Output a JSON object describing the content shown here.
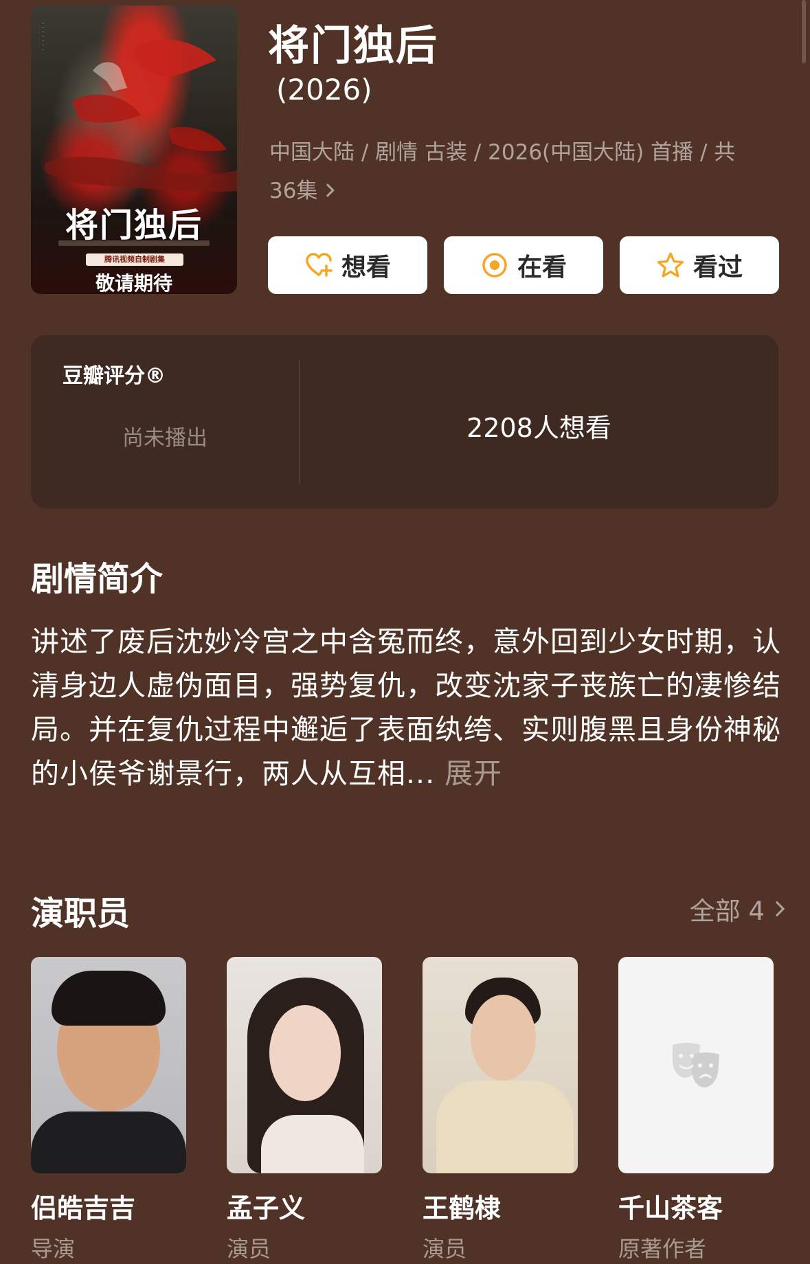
{
  "header": {
    "title": "将门独后",
    "year": "(2026)",
    "meta_line": "中国大陆 / 剧情 古装 / 2026(中国大陆) 首播 / 共 36集"
  },
  "poster": {
    "title": "将门独后",
    "badge": "腾讯视频自制剧集",
    "tagline": "敬请期待"
  },
  "actions": {
    "want": "想看",
    "watching": "在看",
    "watched": "看过"
  },
  "rating": {
    "label": "豆瓣评分®",
    "status": "尚未播出",
    "wish_count": "2208人想看"
  },
  "synopsis": {
    "title": "剧情简介",
    "text": "讲述了废后沈妙冷宫之中含冤而终，意外回到少女时期，认清身边人虚伪面目，强势复仇，改变沈家子丧族亡的凄惨结局。并在复仇过程中邂逅了表面纨绔、实则腹黑且身份神秘的小侯爷谢景行，两人从互相...",
    "expand": "展开"
  },
  "cast": {
    "title": "演职员",
    "all_label": "全部 4",
    "members": [
      {
        "name": "侣皓吉吉",
        "role": "导演"
      },
      {
        "name": "孟子义",
        "role": "演员"
      },
      {
        "name": "王鹤棣",
        "role": "演员"
      },
      {
        "name": "千山茶客",
        "role": "原著作者"
      }
    ]
  },
  "colors": {
    "background": "#503326",
    "card": "#3e2a20",
    "accent": "#f5a623"
  }
}
